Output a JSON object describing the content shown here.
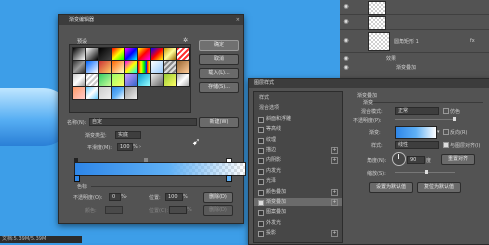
{
  "status_bar": "文档:5.39M/5.39M",
  "gradient_editor": {
    "title": "渐变编辑器",
    "presets_label": "预设",
    "buttons": {
      "ok": "确定",
      "cancel": "取消",
      "load": "载入(L)...",
      "save": "存储(S)...",
      "new": "新建(W)"
    },
    "name_label": "名称(N):",
    "name_value": "自定",
    "type_label": "渐变类型:",
    "type_value": "实底",
    "smooth_label": "平滑度(M):",
    "smooth_value": "100",
    "smooth_unit": "%",
    "stops_label": "色标",
    "opacity_label": "不透明度(O):",
    "opacity_value": "0",
    "opacity_unit": "%",
    "location_label": "位置:",
    "location_value": "100",
    "location_unit": "%",
    "delete_label": "删除(D)",
    "color_label": "颜色:",
    "color_location_label": "位置(C):",
    "color_location_unit": "%",
    "color_delete_label": "删除(D)",
    "gradient_colors": {
      "start": "#2e86e8",
      "mid": "#5fb0f5"
    }
  },
  "layer_style": {
    "title": "图层样式",
    "styles_list": [
      {
        "label": "样式",
        "check": false,
        "plus": false
      },
      {
        "label": "混合选项",
        "check": false,
        "plus": false
      },
      {
        "label": "斜面和浮雕",
        "check": true,
        "plus": false
      },
      {
        "label": "等高线",
        "check": true,
        "plus": false
      },
      {
        "label": "纹理",
        "check": true,
        "plus": false
      },
      {
        "label": "描边",
        "check": true,
        "plus": true
      },
      {
        "label": "内阴影",
        "check": true,
        "plus": true
      },
      {
        "label": "内发光",
        "check": true,
        "plus": false
      },
      {
        "label": "光泽",
        "check": true,
        "plus": false
      },
      {
        "label": "颜色叠加",
        "check": true,
        "plus": true
      },
      {
        "label": "渐变叠加",
        "check": true,
        "plus": true,
        "selected": true,
        "checked": true
      },
      {
        "label": "图案叠加",
        "check": true,
        "plus": false
      },
      {
        "label": "外发光",
        "check": true,
        "plus": false
      },
      {
        "label": "投影",
        "check": true,
        "plus": true
      }
    ],
    "section_title": "渐变叠加",
    "subsection": "渐变",
    "blend_mode_label": "混合模式:",
    "blend_mode_value": "正常",
    "dither_label": "仿色",
    "opacity_label": "不透明度(P):",
    "gradient_label": "渐变:",
    "reverse_label": "反向(R)",
    "style_label": "样式:",
    "style_value": "线性",
    "align_label": "与图层对齐(I)",
    "angle_label": "角度(N):",
    "angle_value": "90",
    "angle_unit": "度",
    "reset_align_label": "重置对齐",
    "scale_label": "缩放(S):",
    "set_default_label": "设置为默认值",
    "reset_default_label": "复位为默认值"
  },
  "layers_panel": {
    "layer_name": "圆角矩形 1",
    "effects_label": "效果",
    "effect_item": "渐变叠加"
  }
}
